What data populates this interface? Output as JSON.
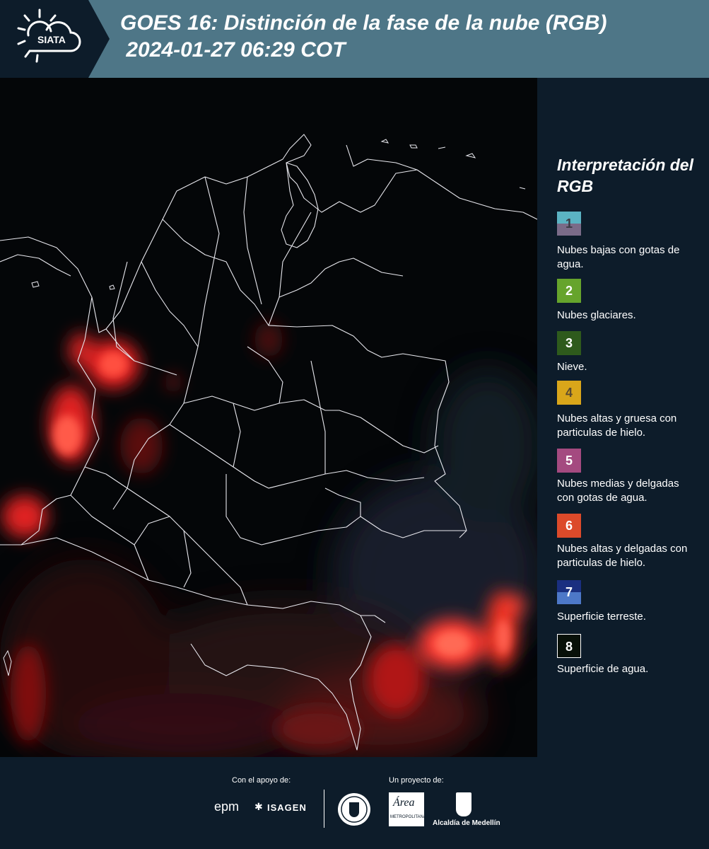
{
  "header": {
    "logo_text": "SIATA",
    "title": "GOES 16: Distinción de la fase de la nube (RGB)\n 2024-01-27 06:29 COT"
  },
  "legend": {
    "title": "Interpretación del RGB",
    "items": [
      {
        "num": "1",
        "label": "Nubes bajas con gotas de agua.",
        "color_top": "#5bb3c3",
        "color_bottom": "#7a6b88"
      },
      {
        "num": "2",
        "label": "Nubes glaciares.",
        "color": "#66a42c"
      },
      {
        "num": "3",
        "label": "Nieve.",
        "color": "#2e5a1c"
      },
      {
        "num": "4",
        "label": "Nubes altas y gruesa con particulas de hielo.",
        "color": "#d9a61a"
      },
      {
        "num": "5",
        "label": "Nubes medias y delgadas con gotas de agua.",
        "color": "#a44a80"
      },
      {
        "num": "6",
        "label": "Nubes altas y delgadas con particulas de hielo.",
        "color": "#dc4a2a"
      },
      {
        "num": "7",
        "label": "Superficie terreste.",
        "color_top": "#1a2f80",
        "color_bottom": "#4d78c8"
      },
      {
        "num": "8",
        "label": "Superficie de agua.",
        "color": "#081008"
      }
    ]
  },
  "footer": {
    "support_label": "Con el apoyo de:",
    "project_label": "Un proyecto de:",
    "sponsor1": "epm",
    "sponsor2": "ISAGEN",
    "partner_area": "Área",
    "partner_area_sub": "METROPOLITANA",
    "partner_alcaldia": "Alcaldía de Medellín"
  }
}
